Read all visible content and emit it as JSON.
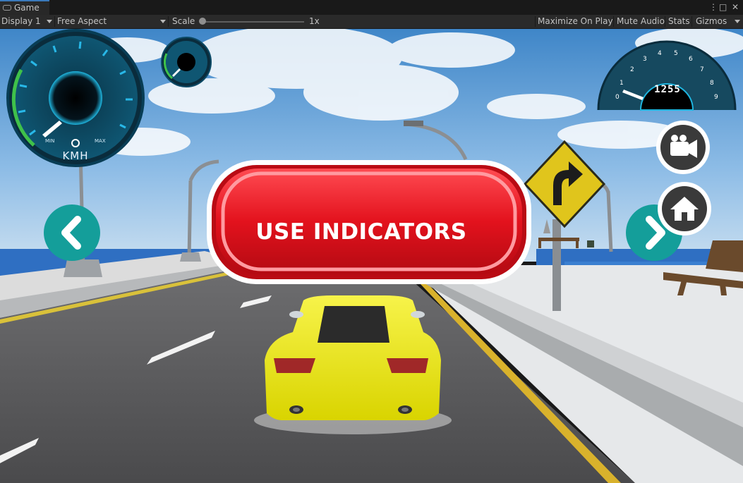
{
  "editor": {
    "tab_label": "Game",
    "more_icon": "⋮",
    "maximize_icon": "□",
    "close_icon": "✕",
    "display": "Display 1",
    "aspect": "Free Aspect",
    "scale_label": "Scale",
    "scale_value": "1x",
    "maximize_on_play": "Maximize On Play",
    "mute_audio": "Mute Audio",
    "stats": "Stats",
    "gizmos": "Gizmos"
  },
  "hud": {
    "speed_unit": "KMH",
    "speed_min": "MIN",
    "speed_max": "MAX",
    "rpm_reading": "1255",
    "rpm_ticks": [
      "0",
      "1",
      "2",
      "3",
      "4",
      "5",
      "6",
      "7",
      "8",
      "9"
    ],
    "message": "USE INDICATORS",
    "left_button_icon": "chevron-left-icon",
    "right_button_icon": "chevron-right-icon",
    "camera_button_icon": "video-camera-icon",
    "home_button_icon": "home-icon",
    "road_sign_icon": "curve-right-arrow-icon"
  },
  "colors": {
    "gauge_cyan": "#28b8e8",
    "gauge_green": "#3fc14a",
    "message_red": "#e3121d",
    "nav_teal": "#149e9a",
    "car_yellow": "#f3ee0c"
  }
}
